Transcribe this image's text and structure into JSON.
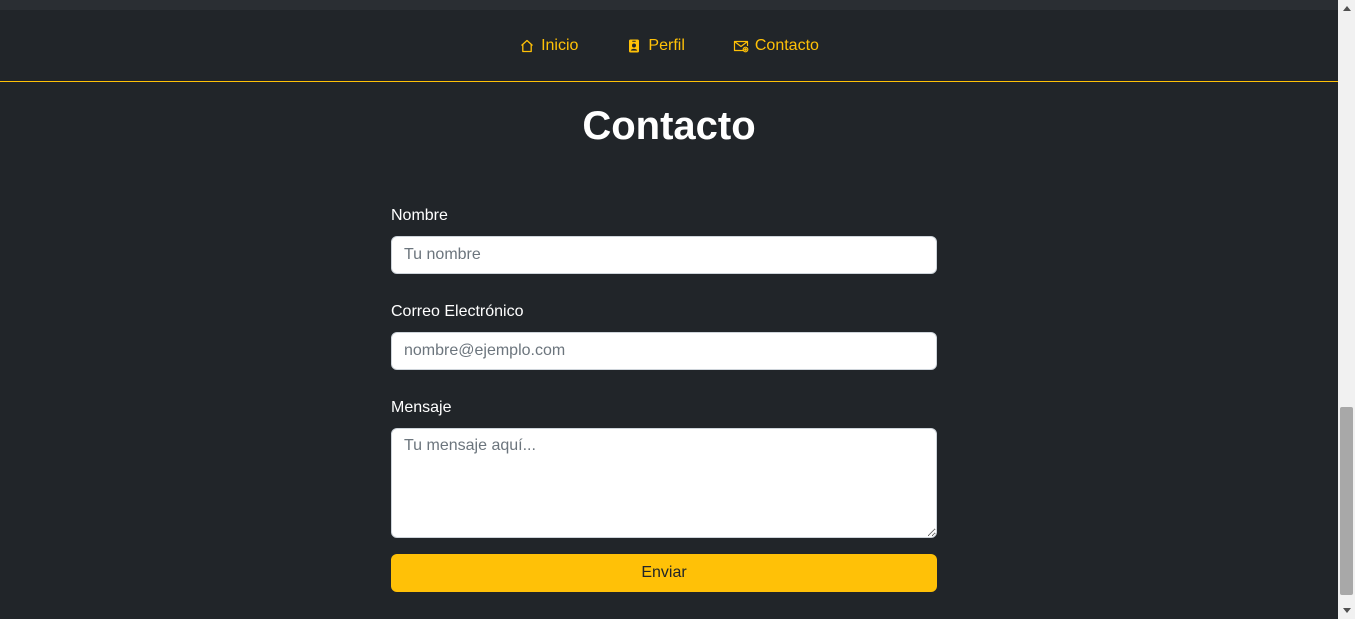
{
  "nav": {
    "items": [
      {
        "label": "Inicio",
        "icon": "house-icon"
      },
      {
        "label": "Perfil",
        "icon": "person-badge-icon"
      },
      {
        "label": "Contacto",
        "icon": "envelope-icon"
      }
    ]
  },
  "page": {
    "title": "Contacto"
  },
  "form": {
    "name_label": "Nombre",
    "name_placeholder": "Tu nombre",
    "email_label": "Correo Electrónico",
    "email_placeholder": "nombre@ejemplo.com",
    "message_label": "Mensaje",
    "message_placeholder": "Tu mensaje aquí...",
    "submit_label": "Enviar"
  },
  "colors": {
    "background": "#212529",
    "accent": "#ffc107",
    "text": "#ffffff"
  }
}
